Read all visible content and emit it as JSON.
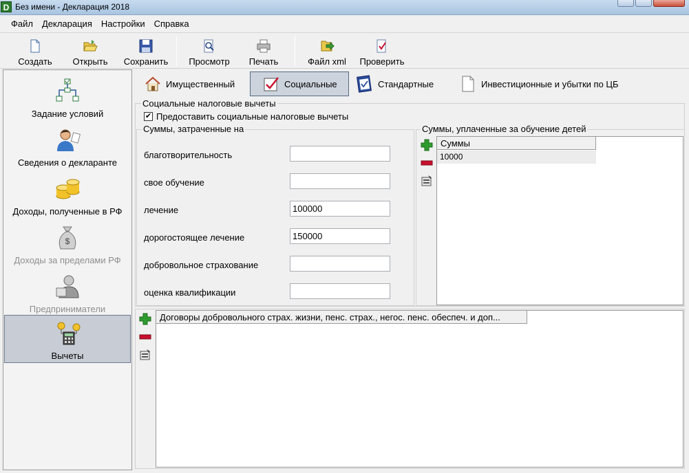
{
  "window": {
    "title": "Без имени - Декларация 2018",
    "app_icon_letter": "D"
  },
  "menu": [
    "Файл",
    "Декларация",
    "Настройки",
    "Справка"
  ],
  "toolbar": {
    "create": "Создать",
    "open": "Открыть",
    "save": "Сохранить",
    "preview": "Просмотр",
    "print": "Печать",
    "xml": "Файл xml",
    "check": "Проверить"
  },
  "sidebar": {
    "items": [
      {
        "label": "Задание условий",
        "icon": "flowchart-icon",
        "enabled": true
      },
      {
        "label": "Сведения о декларанте",
        "icon": "person-icon",
        "enabled": true
      },
      {
        "label": "Доходы, полученные в РФ",
        "icon": "coins-icon",
        "enabled": true
      },
      {
        "label": "Доходы за пределами РФ",
        "icon": "money-bag-icon",
        "enabled": false
      },
      {
        "label": "Предприниматели",
        "icon": "businessman-icon",
        "enabled": false
      },
      {
        "label": "Вычеты",
        "icon": "calculator-icon",
        "enabled": true,
        "active": true
      }
    ]
  },
  "tabs": [
    {
      "label": "Имущественный",
      "icon": "house-icon"
    },
    {
      "label": "Социальные",
      "icon": "checklist-icon",
      "active": true
    },
    {
      "label": "Стандартные",
      "icon": "clipboard-icon"
    },
    {
      "label": "Инвестиционные и убытки по ЦБ",
      "icon": "document-icon"
    }
  ],
  "social": {
    "group_title": "Социальные налоговые вычеты",
    "checkbox_label": "Предоставить социальные налоговые вычеты",
    "checkbox_checked": true,
    "checkbox_mark": "✔",
    "amounts_title": "Суммы, затраченные на",
    "fields": [
      {
        "label": "благотворительность",
        "value": ""
      },
      {
        "label": "свое обучение",
        "value": ""
      },
      {
        "label": "лечение",
        "value": "100000"
      },
      {
        "label": "дорогостоящее лечение",
        "value": "150000"
      },
      {
        "label": "добровольное страхование",
        "value": ""
      },
      {
        "label": "оценка квалификации",
        "value": ""
      }
    ],
    "children_title": "Суммы, уплаченные за обучение детей",
    "children_grid": {
      "header": "Суммы",
      "rows": [
        "10000"
      ]
    },
    "contracts_grid": {
      "header": "Договоры добровольного страх. жизни, пенс. страх., негос. пенс. обеспеч. и доп..."
    }
  },
  "colors": {
    "add": "#2e9b2e",
    "remove": "#c8102e",
    "active_tab": "#cdd3dc"
  }
}
